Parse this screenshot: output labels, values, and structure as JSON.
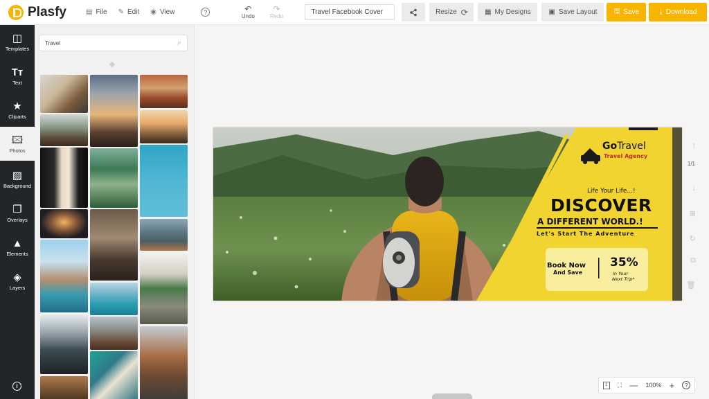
{
  "app": {
    "name": "Plasfy"
  },
  "topbar": {
    "file_label": "File",
    "edit_label": "Edit",
    "view_label": "View",
    "help_symbol": "?",
    "undo_label": "Undo",
    "redo_label": "Redo",
    "design_title": "Travel Facebook Cover",
    "resize_label": "Resize",
    "my_designs_label": "My Designs",
    "save_layout_label": "Save Layout",
    "save_label": "Save",
    "download_label": "Download",
    "accent_color": "#f7b500"
  },
  "sidebar": {
    "items": [
      {
        "label": "Templates",
        "icon": "templates-icon"
      },
      {
        "label": "Text",
        "icon": "text-icon"
      },
      {
        "label": "Cliparts",
        "icon": "star-icon"
      },
      {
        "label": "Photos",
        "icon": "photo-icon"
      },
      {
        "label": "Background",
        "icon": "background-icon"
      },
      {
        "label": "Overlays",
        "icon": "overlays-icon"
      },
      {
        "label": "Elements",
        "icon": "elements-icon"
      },
      {
        "label": "Layers",
        "icon": "layers-icon"
      }
    ],
    "active": "Photos"
  },
  "photos_panel": {
    "search_value": "Travel"
  },
  "banner": {
    "brand_name_bold": "Go",
    "brand_name_light": "Travel",
    "brand_sub": "Travel Agency",
    "tagline": "Life Your Life...!",
    "headline": "DISCOVER",
    "subheadline": "A DIFFERENT WORLD.!",
    "cta_line": "Let's Start The Adventure",
    "book_line1": "Book Now",
    "book_line2": "And Save",
    "discount": "35%",
    "discount_note1": "In Your",
    "discount_note2": "Next Trip*",
    "yellow": "#f2d431",
    "red": "#c0292b"
  },
  "canvas": {
    "page_count": "1/1",
    "zoom": "100%"
  }
}
